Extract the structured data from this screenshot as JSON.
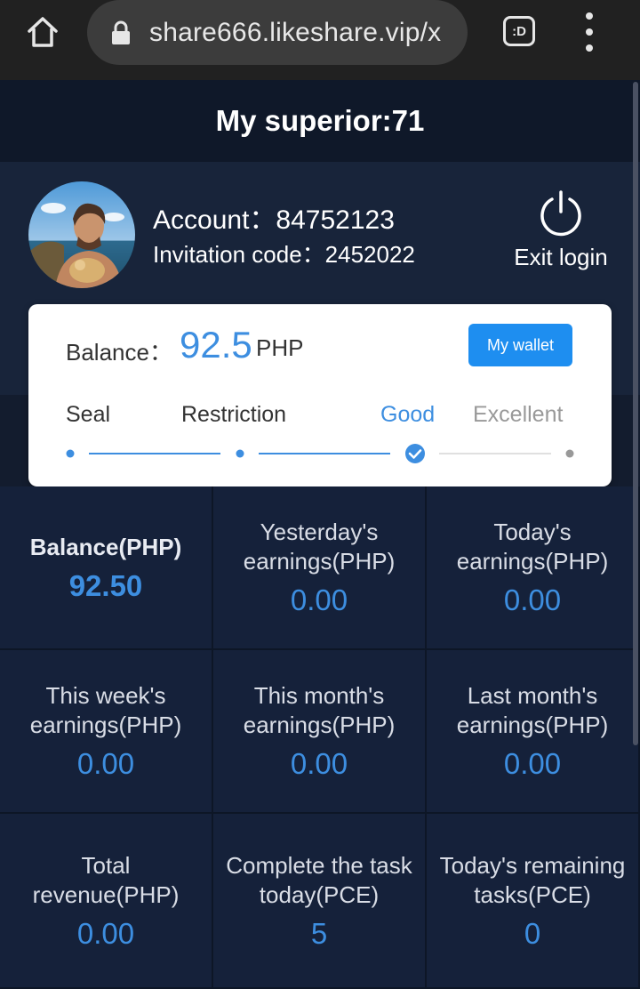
{
  "browser": {
    "url": "share666.likeshare.vip/x",
    "tab_label": ":D"
  },
  "header": {
    "title": "My superior:71"
  },
  "profile": {
    "account": "Account：84752123",
    "invitation": "Invitation code：2452022",
    "exit_label": "Exit login"
  },
  "balance_card": {
    "label": "Balance：",
    "amount": "92.5",
    "currency": "PHP",
    "wallet_button": "My wallet",
    "levels": [
      "Seal",
      "Restriction",
      "Good",
      "Excellent"
    ],
    "current_level": "Good"
  },
  "stats": [
    {
      "label": "Balance(PHP)",
      "value": "92.50"
    },
    {
      "label": "Yesterday's earnings(PHP)",
      "value": "0.00"
    },
    {
      "label": "Today's earnings(PHP)",
      "value": "0.00"
    },
    {
      "label": "This week's earnings(PHP)",
      "value": "0.00"
    },
    {
      "label": "This month's earnings(PHP)",
      "value": "0.00"
    },
    {
      "label": "Last month's earnings(PHP)",
      "value": "0.00"
    },
    {
      "label": "Total revenue(PHP)",
      "value": "0.00"
    },
    {
      "label": "Complete the task today(PCE)",
      "value": "5"
    },
    {
      "label": "Today's remaining tasks(PCE)",
      "value": "0"
    }
  ],
  "colors": {
    "accent": "#3d8ee0",
    "button": "#1e8ef0",
    "background": "#131c2e",
    "header": "#0f1829"
  }
}
